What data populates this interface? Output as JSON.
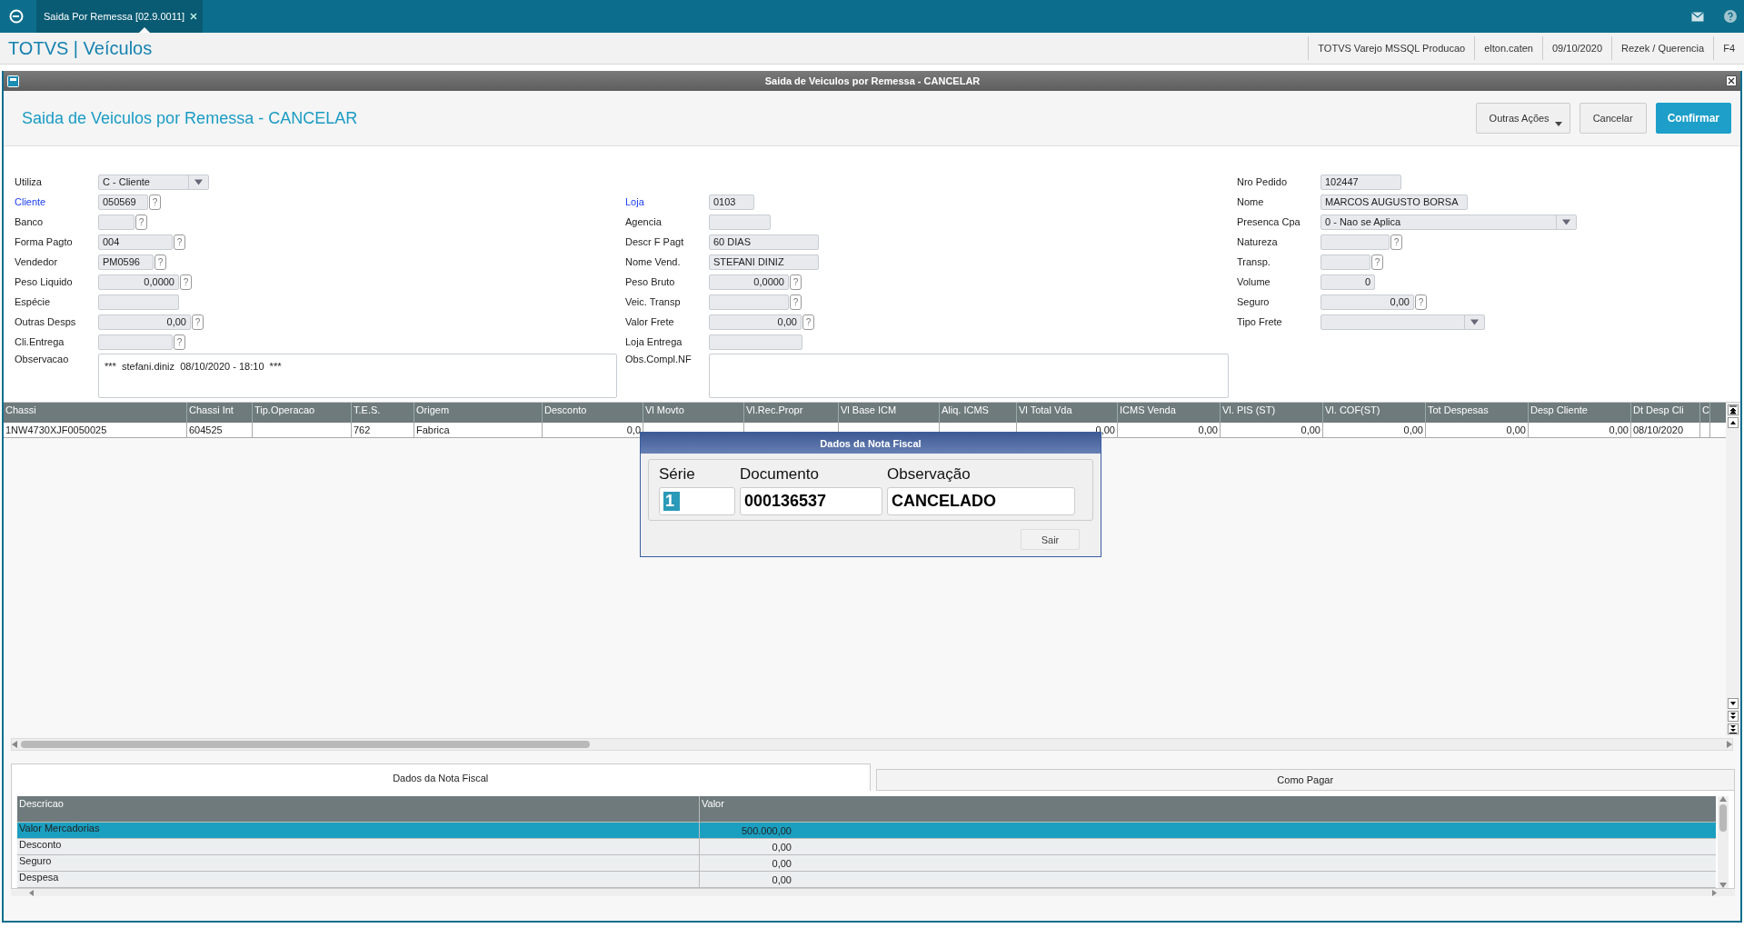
{
  "top_bar": {
    "tabs": [
      {
        "label": "Saida Por Remessa [02.9.0011]",
        "selected": true
      }
    ]
  },
  "app_header": {
    "title": "TOTVS | Veículos",
    "info": [
      "TOTVS Varejo MSSQL Producao",
      "elton.caten",
      "09/10/2020",
      "Rezek / Querencia",
      "F4"
    ]
  },
  "window": {
    "title": "Saida de Veiculos por Remessa - CANCELAR",
    "heading": "Saida de Veiculos por Remessa - CANCELAR",
    "buttons": [
      {
        "label": "Outras Ações",
        "kind": "menu"
      },
      {
        "label": "Cancelar",
        "kind": "plain"
      },
      {
        "label": "Confirmar",
        "kind": "primary"
      }
    ]
  },
  "form": {
    "columns": [
      [
        {
          "label": "Utiliza",
          "value": "C - Cliente",
          "kind": "select",
          "linked": false
        },
        {
          "label": "Cliente",
          "value": "050569",
          "kind": "text",
          "linked": true,
          "lookup": "?"
        },
        {
          "label": "Banco",
          "kind": "text",
          "linked": false,
          "lookup": "?"
        },
        {
          "label": "Forma Pagto",
          "value": "004",
          "kind": "text",
          "linked": false,
          "lookup": "?"
        },
        {
          "label": "Vendedor",
          "value": "PM0596",
          "kind": "text",
          "linked": false,
          "lookup": "?"
        },
        {
          "label": "Peso Liquido",
          "value": "0,0000",
          "kind": "number",
          "linked": false,
          "lookup": "?"
        },
        {
          "label": "Espécie",
          "kind": "text",
          "linked": false
        },
        {
          "label": "Outras Desps",
          "value": "0,00",
          "kind": "number",
          "linked": false,
          "lookup": "?"
        },
        {
          "label": "Cli.Entrega",
          "kind": "text",
          "linked": false,
          "lookup": "?"
        },
        {
          "label": "Observacao",
          "value": "***  stefani.diniz  08/10/2020 - 18:10  ***",
          "kind": "memo",
          "linked": false
        }
      ],
      [
        {
          "label": "Loja",
          "value": "0103",
          "kind": "text",
          "linked": true
        },
        {
          "label": "Agencia",
          "kind": "text",
          "linked": false
        },
        {
          "label": "Descr F Pagt",
          "value": "60 DIAS",
          "kind": "text",
          "linked": false
        },
        {
          "label": "Nome Vend.",
          "value": "STEFANI DINIZ",
          "kind": "text",
          "linked": false
        },
        {
          "label": "Peso Bruto",
          "value": "0,0000",
          "kind": "number",
          "linked": false,
          "lookup": "?"
        },
        {
          "label": "Veic. Transp",
          "kind": "text",
          "linked": false,
          "lookup": "?"
        },
        {
          "label": "Valor Frete",
          "value": "0,00",
          "kind": "number",
          "linked": false,
          "lookup": "?"
        },
        {
          "label": "Loja Entrega",
          "kind": "text",
          "linked": false
        },
        {
          "label": "Obs.Compl.NF",
          "kind": "memo",
          "linked": false
        }
      ],
      [
        {
          "label": "Nro Pedido",
          "value": "102447",
          "kind": "text",
          "linked": false
        },
        {
          "label": "Nome",
          "value": "MARCOS AUGUSTO BORSA",
          "kind": "text",
          "linked": false
        },
        {
          "label": "Presenca Cpa",
          "value": "0 - Nao se Aplica",
          "kind": "select",
          "linked": false
        },
        {
          "label": "Natureza",
          "kind": "text",
          "linked": false,
          "lookup": "?"
        },
        {
          "label": "Transp.",
          "kind": "text",
          "linked": false,
          "lookup": "?"
        },
        {
          "label": "Volume",
          "value": "0",
          "kind": "number",
          "linked": false
        },
        {
          "label": "Seguro",
          "value": "0,00",
          "kind": "number",
          "linked": false,
          "lookup": "?"
        },
        {
          "label": "Tipo Frete",
          "kind": "select",
          "linked": false
        }
      ]
    ]
  },
  "grid": {
    "columns": [
      "Chassi",
      "Chassi Int",
      "Tip.Operacao",
      "T.E.S.",
      "Origem",
      "Desconto",
      "Vl Movto",
      "Vl.Rec.Propr",
      "Vl Base ICM",
      "Aliq. ICMS",
      "Vl Total Vda",
      "ICMS Venda",
      "Vl. PIS (ST)",
      "Vl. COF(ST)",
      "Tot Despesas",
      "Desp Cliente",
      "Dt Desp Cli",
      "C"
    ],
    "rows": [
      {
        "cells": [
          {
            "text": "1NW4730XJF0050025"
          },
          {
            "text": "604525"
          },
          {},
          {
            "text": "762"
          },
          {
            "text": "Fabrica"
          },
          {
            "text": "0,0",
            "numeric": true
          },
          {},
          {},
          {},
          {},
          {
            "text": "0,00",
            "numeric": true
          },
          {
            "text": "0,00",
            "numeric": true
          },
          {
            "text": "0,00",
            "numeric": true
          },
          {
            "text": "0,00",
            "numeric": true
          },
          {
            "text": "0,00",
            "numeric": true
          },
          {
            "text": "0,00",
            "numeric": true
          },
          {
            "text": "08/10/2020"
          },
          {}
        ]
      }
    ]
  },
  "dialog": {
    "title": "Dados da Nota Fiscal",
    "fields": [
      {
        "label": "Série",
        "value": "1",
        "highlighted": true
      },
      {
        "label": "Documento",
        "value": "000136537",
        "highlighted": false
      },
      {
        "label": "Observação",
        "value": "CANCELADO",
        "highlighted": false
      }
    ],
    "button": "Sair"
  },
  "bottom": {
    "tabs": [
      {
        "label": "Dados da Nota Fiscal",
        "selected": true
      },
      {
        "label": "Como Pagar",
        "selected": false
      }
    ],
    "table": {
      "columns": [
        "Descricao",
        "Valor"
      ],
      "rows": [
        {
          "cells": [
            "Valor Mercadorias",
            "500.000,00"
          ],
          "selected": true
        },
        {
          "cells": [
            "Desconto",
            "0,00"
          ],
          "selected": false
        },
        {
          "cells": [
            "Seguro",
            "0,00"
          ],
          "selected": false
        },
        {
          "cells": [
            "Despesa",
            "0,00"
          ],
          "selected": false
        }
      ]
    }
  }
}
